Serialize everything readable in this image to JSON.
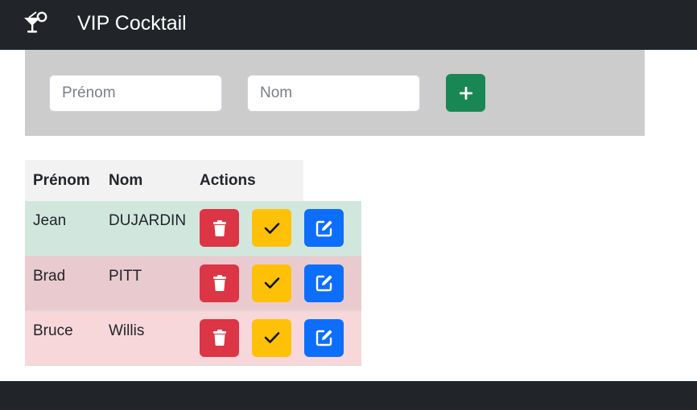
{
  "navbar": {
    "title": "VIP Cocktail",
    "icon": "cocktail-icon"
  },
  "form": {
    "prenom_placeholder": "Prénom",
    "nom_placeholder": "Nom",
    "add_icon": "plus-icon"
  },
  "table": {
    "headers": [
      "Prénom",
      "Nom",
      "Actions"
    ],
    "rows": [
      {
        "prenom": "Jean",
        "nom": "DUJARDIN",
        "status": "success"
      },
      {
        "prenom": "Brad",
        "nom": "PITT",
        "status": "danger"
      },
      {
        "prenom": "Bruce",
        "nom": "Willis",
        "status": "danger"
      }
    ],
    "action_icons": [
      "trash-icon",
      "check-icon",
      "edit-icon"
    ]
  },
  "colors": {
    "navbar": "#212529",
    "panel": "#cccccc",
    "add": "#198754",
    "delete": "#dc3545",
    "check": "#ffc107",
    "edit": "#0d6efd",
    "row_success": "#d1e7dd",
    "row_danger": "#f8d7da"
  }
}
